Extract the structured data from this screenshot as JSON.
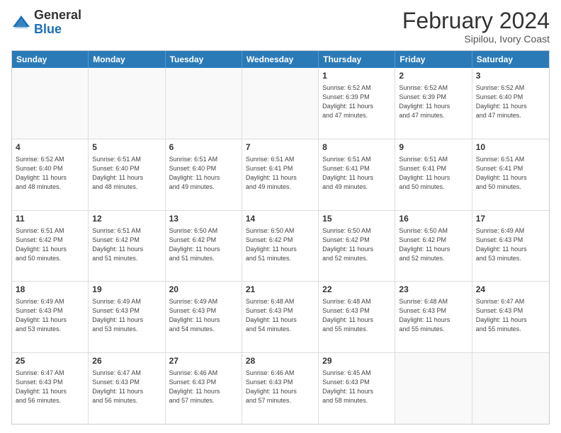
{
  "header": {
    "logo_general": "General",
    "logo_blue": "Blue",
    "month_year": "February 2024",
    "location": "Sipilou, Ivory Coast"
  },
  "weekdays": [
    "Sunday",
    "Monday",
    "Tuesday",
    "Wednesday",
    "Thursday",
    "Friday",
    "Saturday"
  ],
  "rows": [
    [
      {
        "day": "",
        "info": ""
      },
      {
        "day": "",
        "info": ""
      },
      {
        "day": "",
        "info": ""
      },
      {
        "day": "",
        "info": ""
      },
      {
        "day": "1",
        "info": "Sunrise: 6:52 AM\nSunset: 6:39 PM\nDaylight: 11 hours\nand 47 minutes."
      },
      {
        "day": "2",
        "info": "Sunrise: 6:52 AM\nSunset: 6:39 PM\nDaylight: 11 hours\nand 47 minutes."
      },
      {
        "day": "3",
        "info": "Sunrise: 6:52 AM\nSunset: 6:40 PM\nDaylight: 11 hours\nand 47 minutes."
      }
    ],
    [
      {
        "day": "4",
        "info": "Sunrise: 6:52 AM\nSunset: 6:40 PM\nDaylight: 11 hours\nand 48 minutes."
      },
      {
        "day": "5",
        "info": "Sunrise: 6:51 AM\nSunset: 6:40 PM\nDaylight: 11 hours\nand 48 minutes."
      },
      {
        "day": "6",
        "info": "Sunrise: 6:51 AM\nSunset: 6:40 PM\nDaylight: 11 hours\nand 49 minutes."
      },
      {
        "day": "7",
        "info": "Sunrise: 6:51 AM\nSunset: 6:41 PM\nDaylight: 11 hours\nand 49 minutes."
      },
      {
        "day": "8",
        "info": "Sunrise: 6:51 AM\nSunset: 6:41 PM\nDaylight: 11 hours\nand 49 minutes."
      },
      {
        "day": "9",
        "info": "Sunrise: 6:51 AM\nSunset: 6:41 PM\nDaylight: 11 hours\nand 50 minutes."
      },
      {
        "day": "10",
        "info": "Sunrise: 6:51 AM\nSunset: 6:41 PM\nDaylight: 11 hours\nand 50 minutes."
      }
    ],
    [
      {
        "day": "11",
        "info": "Sunrise: 6:51 AM\nSunset: 6:42 PM\nDaylight: 11 hours\nand 50 minutes."
      },
      {
        "day": "12",
        "info": "Sunrise: 6:51 AM\nSunset: 6:42 PM\nDaylight: 11 hours\nand 51 minutes."
      },
      {
        "day": "13",
        "info": "Sunrise: 6:50 AM\nSunset: 6:42 PM\nDaylight: 11 hours\nand 51 minutes."
      },
      {
        "day": "14",
        "info": "Sunrise: 6:50 AM\nSunset: 6:42 PM\nDaylight: 11 hours\nand 51 minutes."
      },
      {
        "day": "15",
        "info": "Sunrise: 6:50 AM\nSunset: 6:42 PM\nDaylight: 11 hours\nand 52 minutes."
      },
      {
        "day": "16",
        "info": "Sunrise: 6:50 AM\nSunset: 6:42 PM\nDaylight: 11 hours\nand 52 minutes."
      },
      {
        "day": "17",
        "info": "Sunrise: 6:49 AM\nSunset: 6:43 PM\nDaylight: 11 hours\nand 53 minutes."
      }
    ],
    [
      {
        "day": "18",
        "info": "Sunrise: 6:49 AM\nSunset: 6:43 PM\nDaylight: 11 hours\nand 53 minutes."
      },
      {
        "day": "19",
        "info": "Sunrise: 6:49 AM\nSunset: 6:43 PM\nDaylight: 11 hours\nand 53 minutes."
      },
      {
        "day": "20",
        "info": "Sunrise: 6:49 AM\nSunset: 6:43 PM\nDaylight: 11 hours\nand 54 minutes."
      },
      {
        "day": "21",
        "info": "Sunrise: 6:48 AM\nSunset: 6:43 PM\nDaylight: 11 hours\nand 54 minutes."
      },
      {
        "day": "22",
        "info": "Sunrise: 6:48 AM\nSunset: 6:43 PM\nDaylight: 11 hours\nand 55 minutes."
      },
      {
        "day": "23",
        "info": "Sunrise: 6:48 AM\nSunset: 6:43 PM\nDaylight: 11 hours\nand 55 minutes."
      },
      {
        "day": "24",
        "info": "Sunrise: 6:47 AM\nSunset: 6:43 PM\nDaylight: 11 hours\nand 55 minutes."
      }
    ],
    [
      {
        "day": "25",
        "info": "Sunrise: 6:47 AM\nSunset: 6:43 PM\nDaylight: 11 hours\nand 56 minutes."
      },
      {
        "day": "26",
        "info": "Sunrise: 6:47 AM\nSunset: 6:43 PM\nDaylight: 11 hours\nand 56 minutes."
      },
      {
        "day": "27",
        "info": "Sunrise: 6:46 AM\nSunset: 6:43 PM\nDaylight: 11 hours\nand 57 minutes."
      },
      {
        "day": "28",
        "info": "Sunrise: 6:46 AM\nSunset: 6:43 PM\nDaylight: 11 hours\nand 57 minutes."
      },
      {
        "day": "29",
        "info": "Sunrise: 6:45 AM\nSunset: 6:43 PM\nDaylight: 11 hours\nand 58 minutes."
      },
      {
        "day": "",
        "info": ""
      },
      {
        "day": "",
        "info": ""
      }
    ]
  ]
}
